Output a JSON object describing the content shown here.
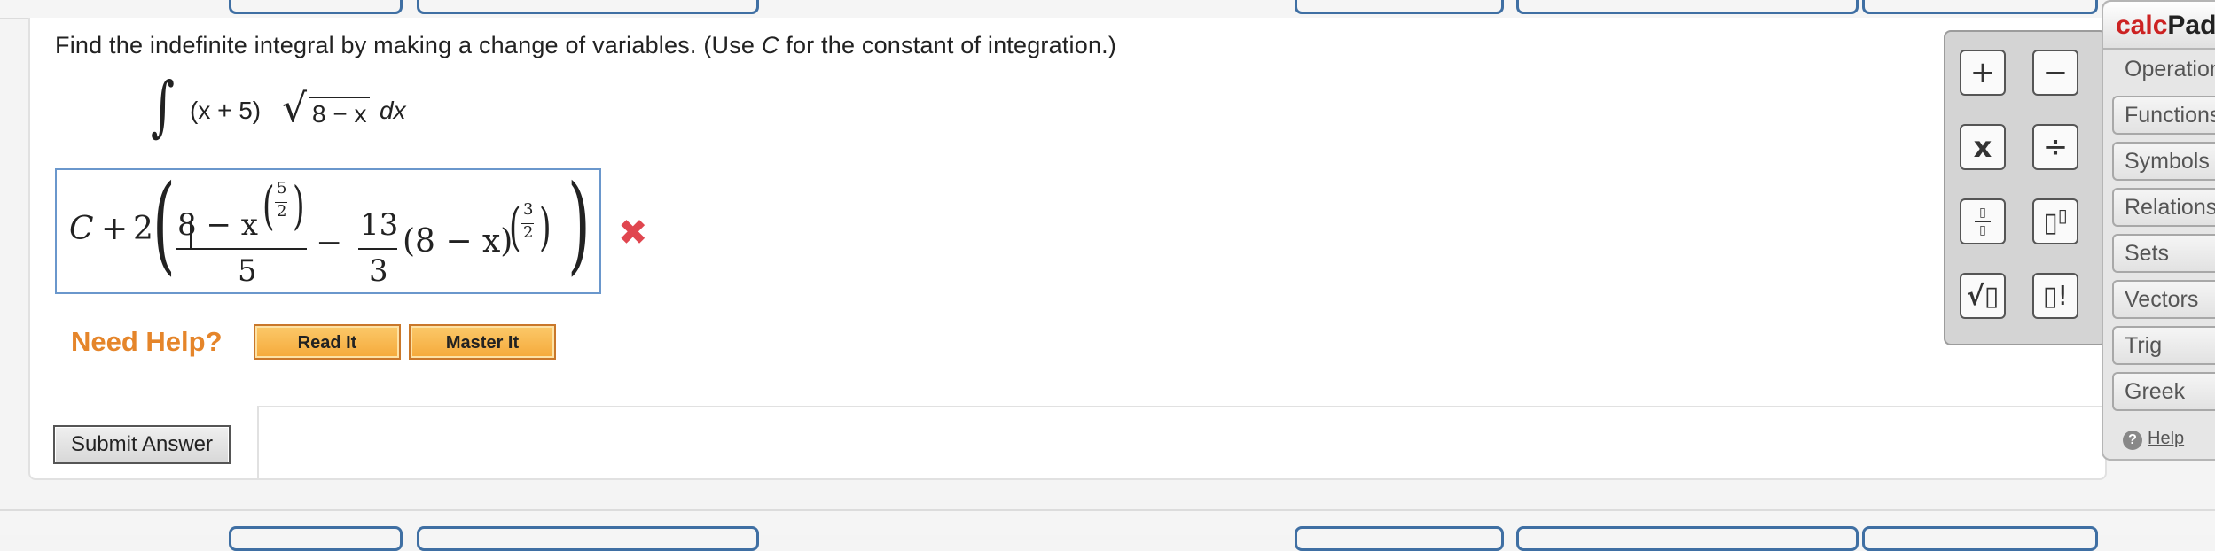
{
  "question": {
    "text_before_c": "Find the indefinite integral by making a change of variables. (Use ",
    "c_symbol": "C",
    "text_after_c": " for the constant of integration.)"
  },
  "integral": {
    "sign": "∫",
    "integrand_prefix": "(x + 5)",
    "radicand": "8 − x",
    "differential": "dx"
  },
  "answer": {
    "constant": "C",
    "plus": "+",
    "coefficient": "2",
    "term1_numerator": "8 − x",
    "term1_exponent_numerator": "5",
    "term1_exponent_denominator": "2",
    "term1_denominator": "5",
    "operator": "−",
    "term2_coefficient_numerator": "13",
    "term2_coefficient_denominator": "3",
    "term2_base": "(8 − x)",
    "term2_exponent_numerator": "3",
    "term2_exponent_denominator": "2",
    "status_icon": "wrong-x-icon",
    "status_color": "#e0464f"
  },
  "help": {
    "label": "Need Help?",
    "read_it": "Read It",
    "master_it": "Master It"
  },
  "submit_label": "Submit Answer",
  "keypad": {
    "plus": "+",
    "minus": "−",
    "times": "x",
    "divide": "÷",
    "fraction_icon": "fraction-icon",
    "power_icon": "power-icon",
    "sqrt_icon": "sqrt-icon",
    "factorial_icon": "factorial-icon"
  },
  "calcpad": {
    "title_part1": "calc",
    "title_part2": "Pad",
    "tabs": [
      "Operations",
      "Functions",
      "Symbols",
      "Relations",
      "Sets",
      "Vectors",
      "Trig",
      "Greek"
    ],
    "help_label": "Help"
  },
  "colors": {
    "accent_blue": "#3f6fa3",
    "need_help_orange": "#e5852a",
    "error_red": "#e0464f",
    "calcpad_red": "#cc2222"
  }
}
